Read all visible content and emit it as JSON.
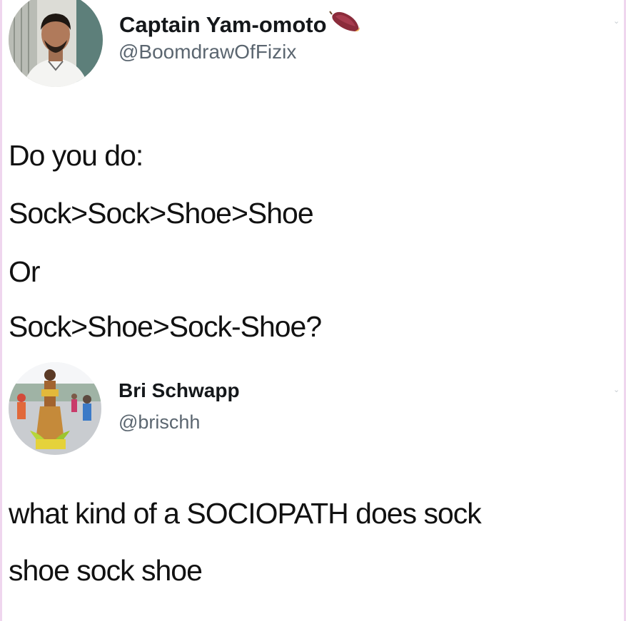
{
  "tweets": [
    {
      "author": {
        "display_name": "Captain Yam-omoto",
        "handle": "@BoomdrawOfFizix",
        "name_emoji": "sweet-potato-icon"
      },
      "text_lines": [
        "Do you do:",
        "Sock>Sock>Shoe>Shoe",
        "Or",
        "Sock>Shoe>Sock-Shoe?"
      ]
    },
    {
      "author": {
        "display_name": "Bri Schwapp",
        "handle": "@brischh"
      },
      "text_lines": [
        "what kind of a SOCIOPATH does sock",
        "shoe sock shoe"
      ]
    }
  ],
  "colors": {
    "name": "#14171a",
    "handle": "#5b6670",
    "text": "#111111",
    "edge": "#efd6ee"
  }
}
